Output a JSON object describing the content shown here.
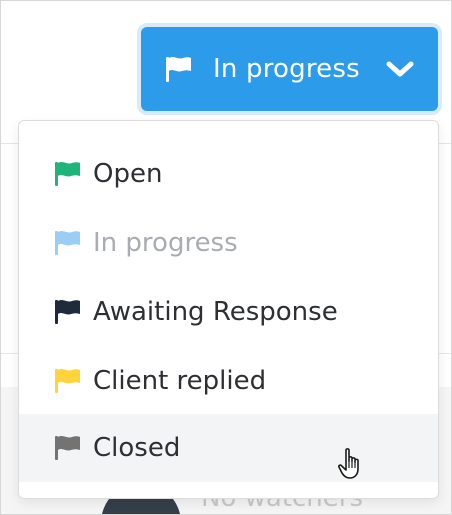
{
  "status_button": {
    "label": "In progress",
    "flag_icon": "flag-icon",
    "chevron_icon": "chevron-down-icon",
    "color": "#2c9bea",
    "text_color": "#ffffff"
  },
  "dropdown": {
    "items": [
      {
        "label": "Open",
        "icon": "flag-icon",
        "flag_color": "#1fb57a",
        "disabled": false
      },
      {
        "label": "In progress",
        "icon": "flag-icon",
        "flag_color": "#9ccdf4",
        "disabled": true
      },
      {
        "label": "Awaiting Response",
        "icon": "flag-icon",
        "flag_color": "#1f2b3a",
        "disabled": false
      },
      {
        "label": "Client replied",
        "icon": "flag-icon",
        "flag_color": "#ffd43b",
        "disabled": false
      },
      {
        "label": "Closed",
        "icon": "flag-icon",
        "flag_color": "#737373",
        "disabled": false,
        "hovered": true
      }
    ]
  },
  "background": {
    "partial_text": "No watchers"
  },
  "cursor": {
    "icon": "hand-pointer-icon"
  }
}
